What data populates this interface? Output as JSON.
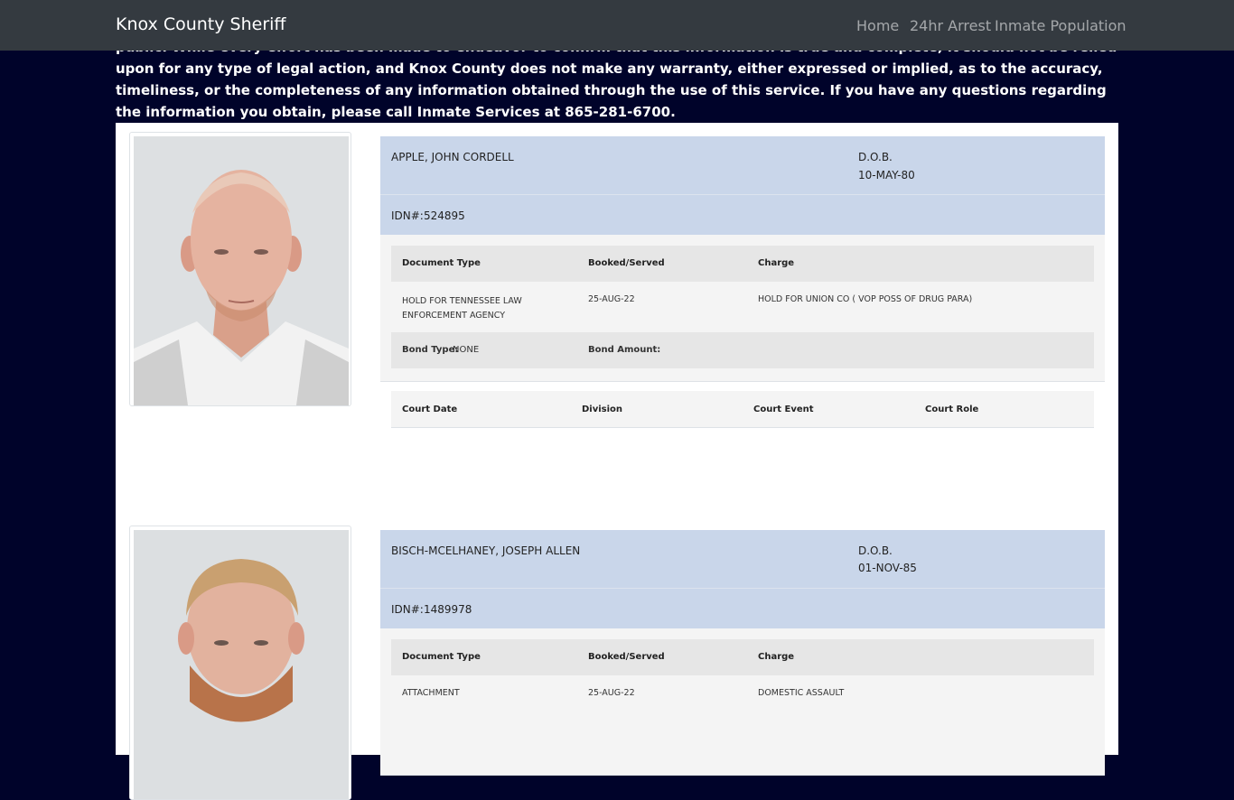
{
  "navbar": {
    "brand": "Knox County Sheriff",
    "links": [
      "Home",
      "24hr Arrest",
      "Inmate Population"
    ]
  },
  "disclaimer": "public. While every effort has been made to endeavor to confirm that this information is true and complete, it should not be relied upon for any type of legal action, and Knox County does not make any warranty, either expressed or implied, as to the accuracy, timeliness, or the completeness of any information obtained through the use of this service. If you have any questions regarding the information you obtain, please call Inmate Services at 865-281-6700.",
  "labels": {
    "dob": "D.O.B.",
    "idn": "IDN#:",
    "document_type": "Document Type",
    "booked_served": "Booked/Served",
    "charge": "Charge",
    "bond_type": "Bond Type:",
    "bond_amount": "Bond Amount:",
    "court_date": "Court Date",
    "division": "Division",
    "court_event": "Court Event",
    "court_role": "Court Role"
  },
  "inmates": [
    {
      "name": "APPLE, JOHN CORDELL",
      "dob": "10-MAY-80",
      "idn": "524895",
      "records": [
        {
          "document_type": "HOLD FOR TENNESSEE LAW ENFORCEMENT AGENCY",
          "booked_served": "25-AUG-22",
          "charge": "HOLD FOR UNION CO ( VOP POSS OF DRUG PARA)"
        }
      ],
      "bond_type": "NONE",
      "bond_amount": ""
    },
    {
      "name": "BISCH-MCELHANEY, JOSEPH ALLEN",
      "dob": "01-NOV-85",
      "idn": "1489978",
      "records": [
        {
          "document_type": "ATTACHMENT",
          "booked_served": "25-AUG-22",
          "charge": "DOMESTIC ASSAULT"
        }
      ]
    }
  ],
  "colors": {
    "page_bg": "#00032a",
    "navbar_bg": "#343a40",
    "header_blue": "#c9d6ea"
  }
}
